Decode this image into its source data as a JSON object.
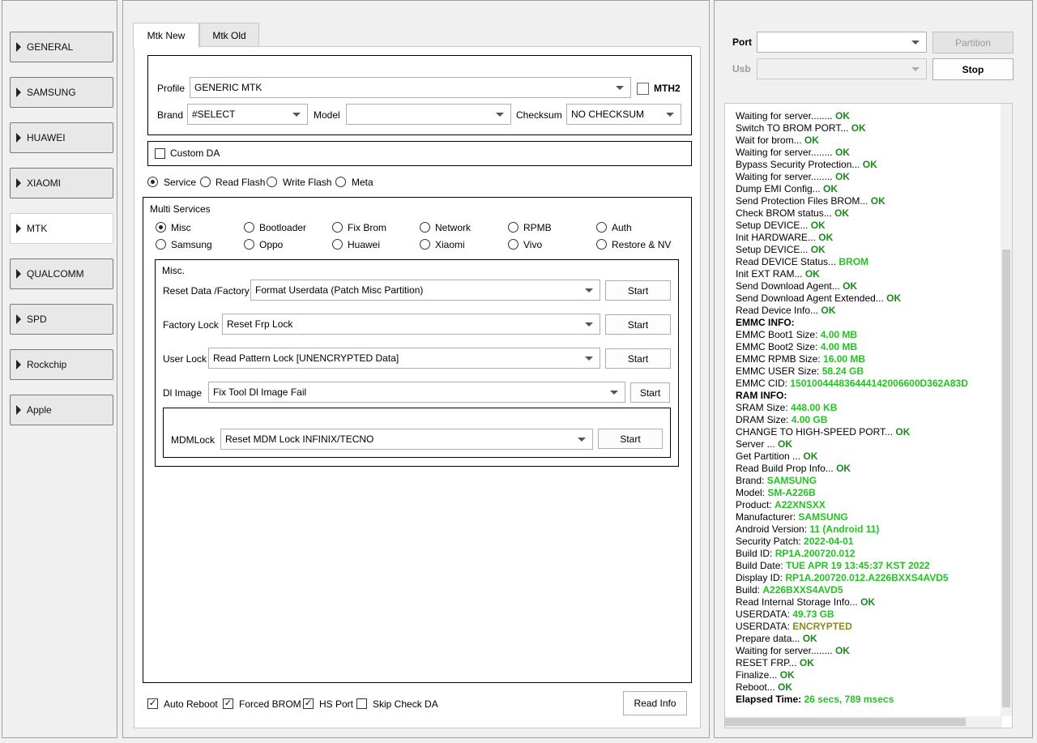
{
  "sidebar": {
    "items": [
      {
        "label": "GENERAL"
      },
      {
        "label": "SAMSUNG"
      },
      {
        "label": "HUAWEI"
      },
      {
        "label": "XIAOMI"
      },
      {
        "label": "MTK"
      },
      {
        "label": "QUALCOMM"
      },
      {
        "label": "SPD"
      },
      {
        "label": "Rockchip"
      },
      {
        "label": "Apple"
      }
    ],
    "active": "MTK"
  },
  "tabs": [
    {
      "label": "Mtk New"
    },
    {
      "label": "Mtk Old"
    }
  ],
  "profile": {
    "label": "Profile",
    "value": "GENERIC MTK",
    "mth2_label": "MTH2"
  },
  "brand": {
    "label": "Brand",
    "value": "#SELECT"
  },
  "model": {
    "label": "Model",
    "value": ""
  },
  "checksum": {
    "label": "Checksum",
    "value": "NO CHECKSUM"
  },
  "custom_da": {
    "label": "Custom DA",
    "checked": false
  },
  "modes": [
    {
      "label": "Service",
      "selected": true
    },
    {
      "label": "Read Flash",
      "selected": false
    },
    {
      "label": "Write Flash",
      "selected": false
    },
    {
      "label": "Meta",
      "selected": false
    }
  ],
  "multi_services": {
    "title": "Multi Services",
    "options": [
      {
        "label": "Misc",
        "selected": true
      },
      {
        "label": "Bootloader",
        "selected": false
      },
      {
        "label": "Fix Brom",
        "selected": false
      },
      {
        "label": "Network",
        "selected": false
      },
      {
        "label": "RPMB",
        "selected": false
      },
      {
        "label": "Auth",
        "selected": false
      },
      {
        "label": "Samsung",
        "selected": false
      },
      {
        "label": "Oppo",
        "selected": false
      },
      {
        "label": "Huawei",
        "selected": false
      },
      {
        "label": "Xiaomi",
        "selected": false
      },
      {
        "label": "Vivo",
        "selected": false
      },
      {
        "label": "Restore & NV",
        "selected": false
      }
    ]
  },
  "misc": {
    "title": "Misc.",
    "rows": [
      {
        "label": "Reset Data /Factory",
        "value": "Format Userdata (Patch Misc Partition)",
        "button": "Start"
      },
      {
        "label": "Factory Lock",
        "value": "Reset Frp Lock",
        "button": "Start"
      },
      {
        "label": "User Lock",
        "value": "Read Pattern Lock [UNENCRYPTED Data]",
        "button": "Start"
      },
      {
        "label": "Dl Image",
        "value": "Fix Tool Dl Image Fail",
        "button": "Start"
      },
      {
        "label": "MDMLock",
        "value": "Reset MDM Lock INFINIX/TECNO",
        "button": "Start"
      }
    ]
  },
  "bottom": {
    "auto_reboot": {
      "label": "Auto Reboot",
      "checked": true
    },
    "forced_brom": {
      "label": "Forced BROM",
      "checked": true
    },
    "hs_port": {
      "label": "HS Port",
      "checked": true
    },
    "skip_check_da": {
      "label": "Skip Check DA",
      "checked": false
    },
    "read_info": "Read Info"
  },
  "right": {
    "port_label": "Port",
    "port_value": "",
    "partition_button": "Partition",
    "usb_label": "Usb",
    "usb_value": "",
    "stop_button": "Stop"
  },
  "colors": {
    "ok": "#1a8a1a",
    "value": "#22c322",
    "warning": "#8a8a1a"
  },
  "log": [
    {
      "text": "Waiting for server........ ",
      "tag": "OK",
      "style": "ok"
    },
    {
      "text": "Switch TO BROM PORT... ",
      "tag": "OK",
      "style": "ok"
    },
    {
      "text": "Wait for brom... ",
      "tag": "OK",
      "style": "ok"
    },
    {
      "text": "Waiting for server........ ",
      "tag": "OK",
      "style": "ok"
    },
    {
      "text": "Bypass Security Protection... ",
      "tag": "OK",
      "style": "ok"
    },
    {
      "text": "Waiting for server........ ",
      "tag": "OK",
      "style": "ok"
    },
    {
      "text": "Dump EMI Config... ",
      "tag": "OK",
      "style": "ok"
    },
    {
      "text": "Send Protection Files BROM... ",
      "tag": "OK",
      "style": "ok"
    },
    {
      "text": "Check BROM status... ",
      "tag": "OK",
      "style": "ok"
    },
    {
      "text": "Setup DEVICE... ",
      "tag": "OK",
      "style": "ok"
    },
    {
      "text": "Init HARDWARE... ",
      "tag": "OK",
      "style": "ok"
    },
    {
      "text": "Setup DEVICE... ",
      "tag": "OK",
      "style": "ok"
    },
    {
      "text": "Read DEVICE Status... ",
      "tag": "BROM",
      "style": "val"
    },
    {
      "text": "Init EXT RAM... ",
      "tag": "OK",
      "style": "ok"
    },
    {
      "text": "Send Download Agent... ",
      "tag": "OK",
      "style": "ok"
    },
    {
      "text": "Send Download Agent Extended... ",
      "tag": "OK",
      "style": "ok"
    },
    {
      "text": "Read Device Info... ",
      "tag": "OK",
      "style": "ok"
    },
    {
      "text": "EMMC INFO:",
      "tag": "",
      "style": "bold"
    },
    {
      "text": "EMMC Boot1 Size: ",
      "tag": "4.00 MB",
      "style": "val"
    },
    {
      "text": "EMMC Boot2 Size: ",
      "tag": "4.00 MB",
      "style": "val"
    },
    {
      "text": "EMMC RPMB Size: ",
      "tag": "16.00 MB",
      "style": "val"
    },
    {
      "text": "EMMC USER Size: ",
      "tag": "58.24 GB",
      "style": "val"
    },
    {
      "text": "EMMC CID: ",
      "tag": "150100444836444142006600D362A83D",
      "style": "val"
    },
    {
      "text": "RAM INFO:",
      "tag": "",
      "style": "bold"
    },
    {
      "text": "SRAM Size: ",
      "tag": "448.00 KB",
      "style": "val"
    },
    {
      "text": "DRAM Size: ",
      "tag": "4.00 GB",
      "style": "val"
    },
    {
      "text": "CHANGE TO HIGH-SPEED PORT... ",
      "tag": "OK",
      "style": "ok"
    },
    {
      "text": "Server ... ",
      "tag": "OK",
      "style": "ok"
    },
    {
      "text": "Get Partition ... ",
      "tag": "OK",
      "style": "ok"
    },
    {
      "text": "Read Build Prop Info... ",
      "tag": "OK",
      "style": "ok"
    },
    {
      "text": " Brand: ",
      "tag": "SAMSUNG",
      "style": "val"
    },
    {
      "text": " Model: ",
      "tag": "SM-A226B",
      "style": "val"
    },
    {
      "text": " Product: ",
      "tag": "A22XNSXX",
      "style": "val"
    },
    {
      "text": " Manufacturer: ",
      "tag": "SAMSUNG",
      "style": "val"
    },
    {
      "text": " Android Version: ",
      "tag": "11 (Android 11)",
      "style": "val"
    },
    {
      "text": " Security Patch: ",
      "tag": "2022-04-01",
      "style": "val"
    },
    {
      "text": " Build ID: ",
      "tag": "RP1A.200720.012",
      "style": "val"
    },
    {
      "text": " Build Date: ",
      "tag": "TUE APR 19 13:45:37 KST 2022",
      "style": "val"
    },
    {
      "text": " Display ID: ",
      "tag": "RP1A.200720.012.A226BXXS4AVD5",
      "style": "val"
    },
    {
      "text": " Build: ",
      "tag": "A226BXXS4AVD5",
      "style": "val"
    },
    {
      "text": "Read Internal Storage Info... ",
      "tag": "OK",
      "style": "ok"
    },
    {
      "text": "USERDATA: ",
      "tag": "49.73 GB",
      "style": "val"
    },
    {
      "text": "USERDATA: ",
      "tag": "ENCRYPTED",
      "style": "warn"
    },
    {
      "text": "Prepare data... ",
      "tag": "OK",
      "style": "ok"
    },
    {
      "text": "Waiting for server........ ",
      "tag": "OK",
      "style": "ok"
    },
    {
      "text": "RESET FRP... ",
      "tag": "OK",
      "style": "ok"
    },
    {
      "text": "Finalize... ",
      "tag": "OK",
      "style": "ok"
    },
    {
      "text": "Reboot... ",
      "tag": "OK",
      "style": "ok"
    },
    {
      "text": "Elapsed Time: ",
      "tag": "26 secs, 789 msecs",
      "style": "val-bold"
    }
  ]
}
